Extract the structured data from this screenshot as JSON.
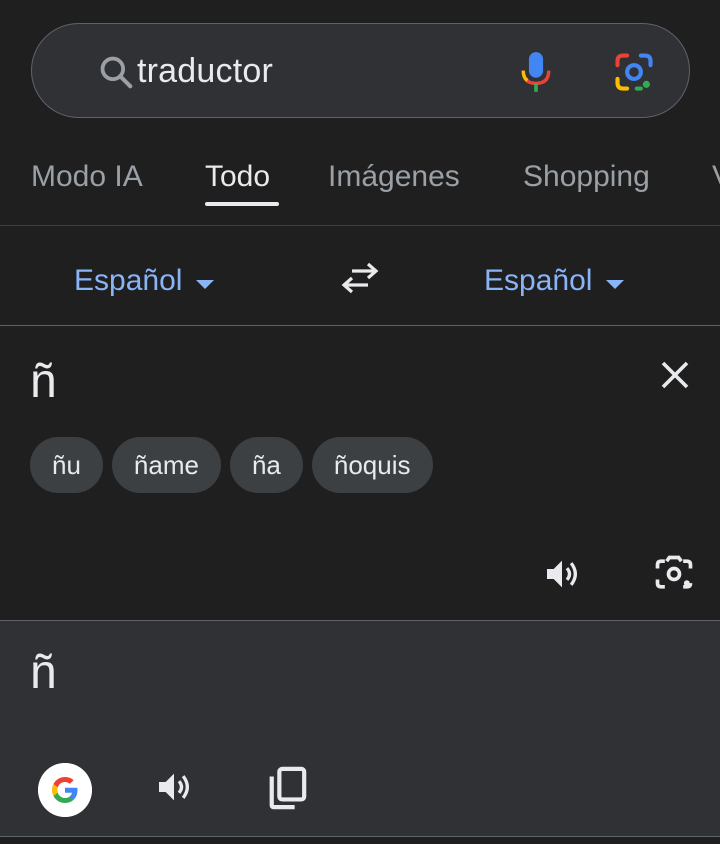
{
  "search": {
    "query": "traductor",
    "icons": {
      "search": "search-icon",
      "mic": "mic-icon",
      "lens": "google-lens-icon"
    }
  },
  "tabs": [
    {
      "label": "Modo IA"
    },
    {
      "label": "Todo",
      "active": true
    },
    {
      "label": "Imágenes"
    },
    {
      "label": "Shopping"
    },
    {
      "label": "V"
    }
  ],
  "translator": {
    "source_lang": "Español",
    "target_lang": "Español",
    "source_text": "ñ",
    "suggestions": [
      "ñu",
      "ñame",
      "ña",
      "ñoquis"
    ],
    "target_text": "ñ"
  },
  "colors": {
    "background": "#1f1f1f",
    "panel": "#303134",
    "accent": "#8ab4f8",
    "chip": "#3c4043"
  }
}
